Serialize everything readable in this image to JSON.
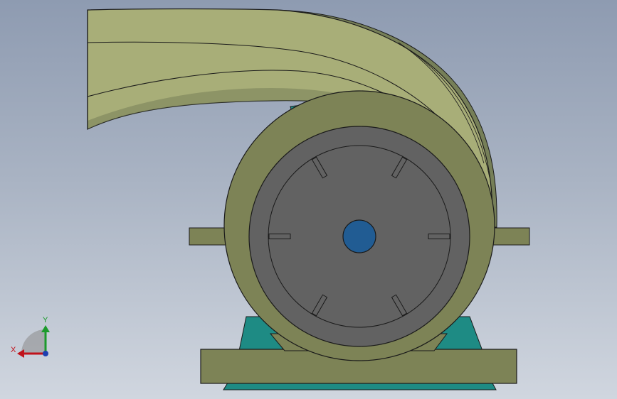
{
  "viewport": {
    "background_top": "#8e9bb1",
    "background_bottom": "#d0d6df"
  },
  "model": {
    "volute_color": "#a8ae78",
    "volute_shadow": "#767f58",
    "housing_color": "#7d8356",
    "base_color": "#7d8356",
    "inner_disc_color": "#626262",
    "shaft_color": "#215c93",
    "stand_color": "#1e8b84",
    "edge_color": "#1a1a1a"
  },
  "triad": {
    "x_label": "X",
    "y_label": "Y",
    "x_color": "#c0121b",
    "y_color": "#1c9a2c",
    "z_color": "#1e3fb0",
    "icons": [
      "x-axis-arrow-icon",
      "y-axis-arrow-icon",
      "z-axis-dot-icon"
    ]
  }
}
